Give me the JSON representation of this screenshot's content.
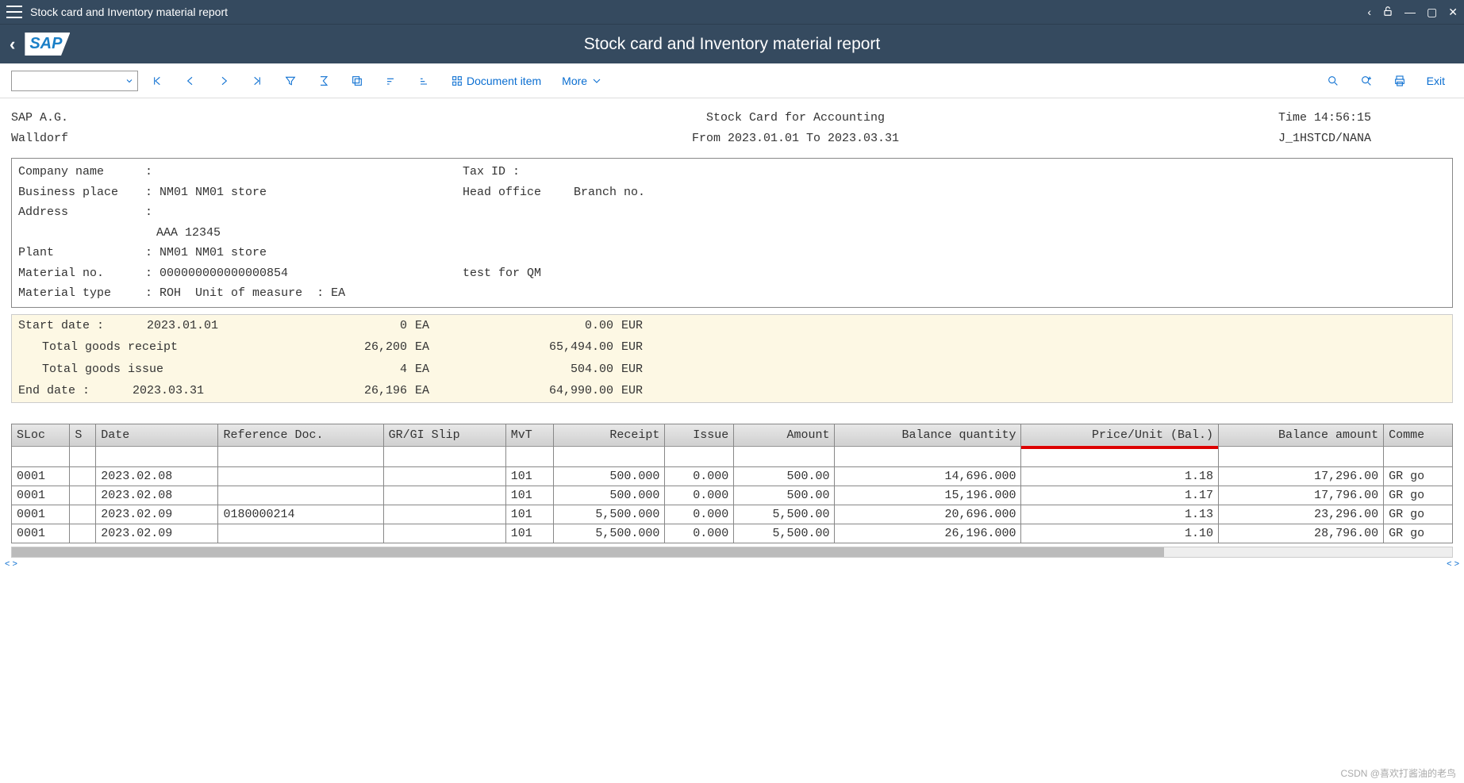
{
  "window": {
    "title": "Stock card and Inventory material report"
  },
  "app": {
    "title": "Stock card and Inventory material report",
    "logo_text": "SAP"
  },
  "toolbar": {
    "document_item": "Document item",
    "more": "More",
    "exit": "Exit"
  },
  "report": {
    "company_short": "SAP A.G.",
    "company_city": "Walldorf",
    "title": "Stock Card for Accounting",
    "subtitle": "From 2023.01.01 To 2023.03.31",
    "time_label": "Time 14:56:15",
    "prog_id": "J_1HSTCD/NANA",
    "info": {
      "company_name_label": "Company name",
      "company_name_value": "",
      "tax_id_label": "Tax ID :",
      "business_place_label": "Business place",
      "business_place_value": "NM01 NM01 store",
      "head_office_label": "Head office",
      "branch_no_label": "Branch no.",
      "address_label": "Address",
      "address_value": "",
      "address_line2": "AAA 12345",
      "plant_label": "Plant",
      "plant_value": "NM01 NM01 store",
      "material_no_label": "Material no.",
      "material_no_value": "000000000000000854",
      "material_desc": "test for QM",
      "material_type_label": "Material type",
      "material_type_value": "ROH",
      "uom_label": "Unit of measure",
      "uom_value": "EA"
    },
    "summary": {
      "start_label": "Start date :",
      "start_date": "2023.01.01",
      "start_qty": "0",
      "start_uom": "EA",
      "start_amt": "0.00",
      "start_cur": "EUR",
      "receipt_label": "Total goods receipt",
      "receipt_qty": "26,200",
      "receipt_uom": "EA",
      "receipt_amt": "65,494.00",
      "receipt_cur": "EUR",
      "issue_label": "Total goods issue",
      "issue_qty": "4",
      "issue_uom": "EA",
      "issue_amt": "504.00",
      "issue_cur": "EUR",
      "end_label": "End date   :",
      "end_date": "2023.03.31",
      "end_qty": "26,196",
      "end_uom": "EA",
      "end_amt": "64,990.00",
      "end_cur": "EUR"
    },
    "columns": {
      "sloc": "SLoc",
      "s": "S",
      "date": "Date",
      "refdoc": "Reference Doc.",
      "grgi": "GR/GI Slip",
      "mvt": "MvT",
      "receipt": "Receipt",
      "issue": "Issue",
      "amount": "Amount",
      "balqty": "Balance quantity",
      "priceunit": "Price/Unit (Bal.)",
      "balamt": "Balance amount",
      "comment": "Comme"
    },
    "rows": [
      {
        "sloc": "0001",
        "s": "",
        "date": "2023.02.08",
        "ref": "",
        "grgi": "",
        "mvt": "101",
        "receipt": "500.000",
        "issue": "0.000",
        "amount": "500.00",
        "balqty": "14,696.000",
        "pu": "1.18",
        "balamt": "17,296.00",
        "comment": "GR go"
      },
      {
        "sloc": "0001",
        "s": "",
        "date": "2023.02.08",
        "ref": "",
        "grgi": "",
        "mvt": "101",
        "receipt": "500.000",
        "issue": "0.000",
        "amount": "500.00",
        "balqty": "15,196.000",
        "pu": "1.17",
        "balamt": "17,796.00",
        "comment": "GR go"
      },
      {
        "sloc": "0001",
        "s": "",
        "date": "2023.02.09",
        "ref": "0180000214",
        "grgi": "",
        "mvt": "101",
        "receipt": "5,500.000",
        "issue": "0.000",
        "amount": "5,500.00",
        "balqty": "20,696.000",
        "pu": "1.13",
        "balamt": "23,296.00",
        "comment": "GR go"
      },
      {
        "sloc": "0001",
        "s": "",
        "date": "2023.02.09",
        "ref": "",
        "grgi": "",
        "mvt": "101",
        "receipt": "5,500.000",
        "issue": "0.000",
        "amount": "5,500.00",
        "balqty": "26,196.000",
        "pu": "1.10",
        "balamt": "28,796.00",
        "comment": "GR go"
      }
    ]
  },
  "watermark": "CSDN @喜欢打酱油的老鸟"
}
